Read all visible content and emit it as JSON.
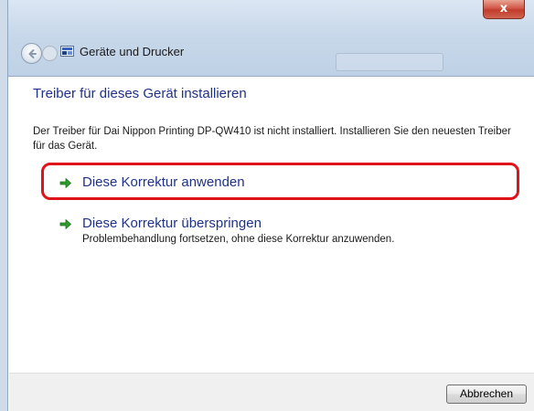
{
  "window": {
    "title": "Geräte und Drucker",
    "close_label": "x"
  },
  "content": {
    "heading": "Treiber für dieses Gerät installieren",
    "description": "Der Treiber für Dai Nippon Printing DP-QW410 ist nicht installiert. Installieren Sie den neuesten Treiber für das Gerät.",
    "options": [
      {
        "label": "Diese Korrektur anwenden",
        "highlighted": true
      },
      {
        "label": "Diese Korrektur überspringen",
        "sublabel": "Problembehandlung fortsetzen, ohne diese Korrektur anzuwenden."
      }
    ]
  },
  "footer": {
    "cancel_label": "Abbrechen"
  },
  "colors": {
    "link": "#1e3287",
    "highlight_border": "#e0121a",
    "arrow_green": "#2e9b2e",
    "close_button": "#c13c2b"
  },
  "icons": {
    "back": "back-arrow-icon",
    "forward": "forward-arrow-icon",
    "devices": "devices-printers-icon",
    "option_arrow": "green-arrow-icon"
  }
}
